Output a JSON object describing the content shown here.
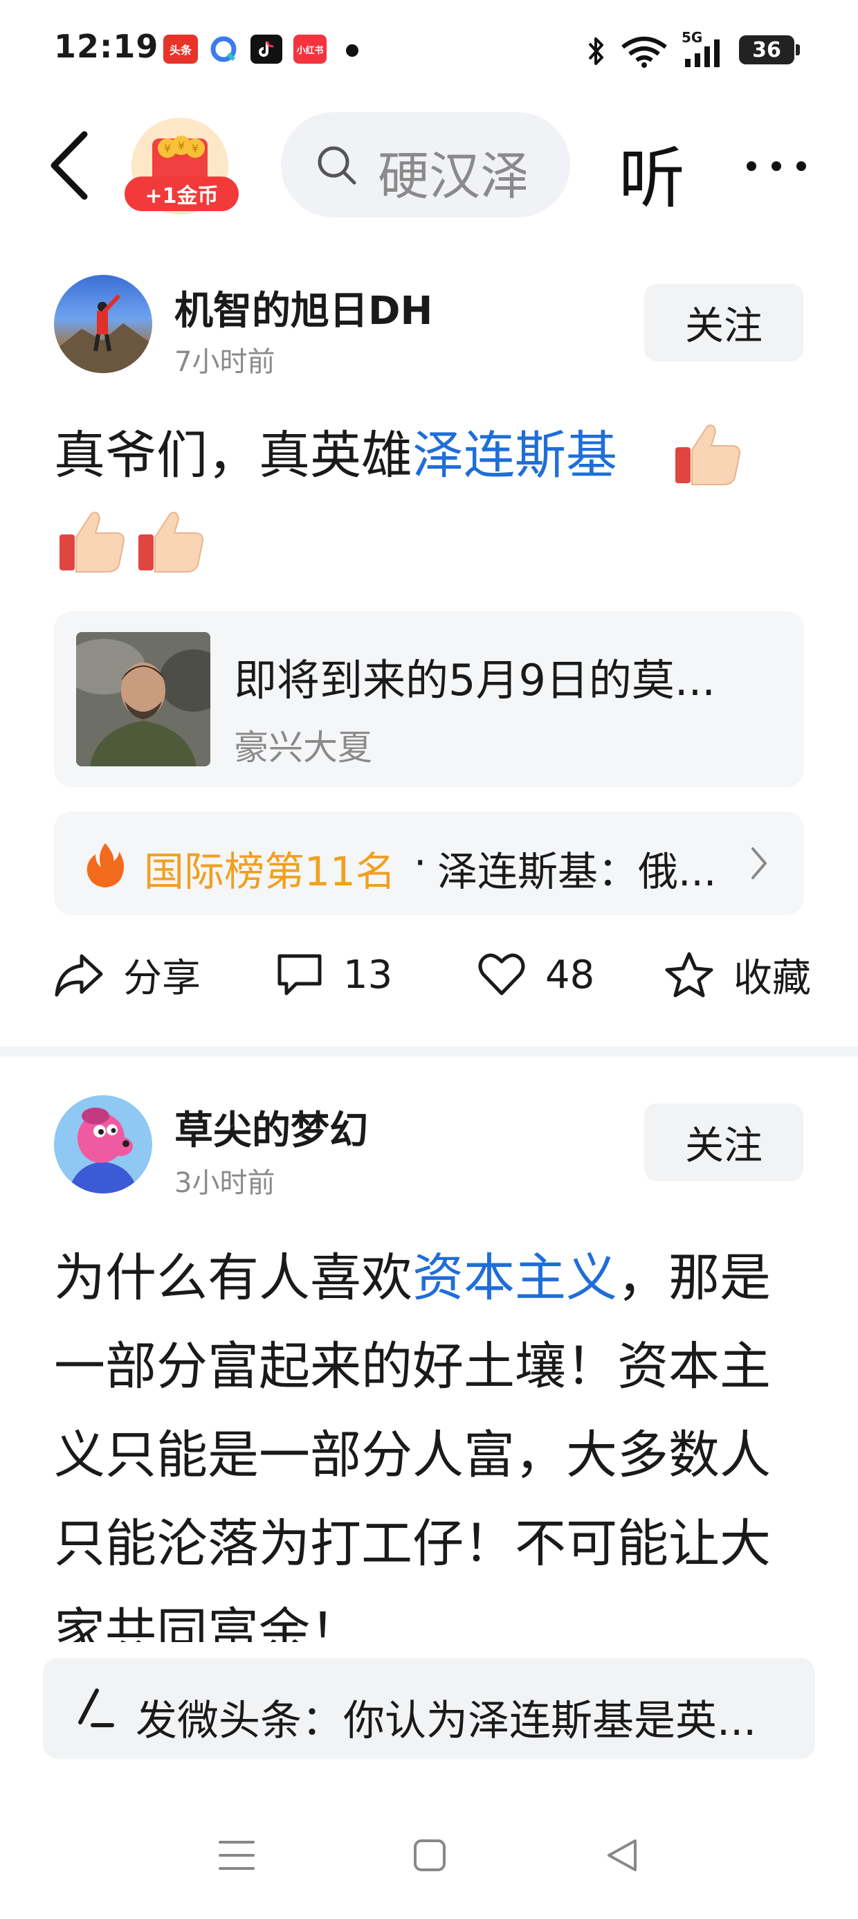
{
  "status_bar": {
    "time": "12:19",
    "app_icons": [
      {
        "name": "toutiao-app-icon",
        "label": "头条",
        "color": "#e8322a"
      },
      {
        "name": "browser-app-icon",
        "label": "",
        "color": "#3a7bf0"
      },
      {
        "name": "douyin-app-icon",
        "label": "",
        "color": "#111111"
      },
      {
        "name": "xiaohongshu-app-icon",
        "label": "小红书",
        "color": "#f5333f"
      }
    ],
    "network": "5G",
    "battery": "36"
  },
  "nav": {
    "coin_badge": "+1金币",
    "search_placeholder": "硬汉泽",
    "listen_label": "听"
  },
  "posts": [
    {
      "author": "机智的旭日DH",
      "time": "7小时前",
      "follow_label": "关注",
      "body_prefix": "真爷们，真英雄",
      "body_link": "泽连斯基",
      "body_suffix": "",
      "emojis": [
        "thumbs-up",
        "thumbs-up",
        "thumbs-up"
      ],
      "quoted_card": {
        "title": "即将到来的5月9日的莫...",
        "source": "豪兴大夏"
      },
      "ranking": {
        "rank_label": "国际榜第11名",
        "separator": "·",
        "topic": "泽连斯基：俄..."
      },
      "actions": {
        "share_label": "分享",
        "comment_count": "13",
        "like_count": "48",
        "favorite_label": "收藏"
      }
    },
    {
      "author": "草尖的梦幻",
      "time": "3小时前",
      "follow_label": "关注",
      "body_prefix": "为什么有人喜欢",
      "body_link": "资本主义",
      "body_suffix": "，那是一部分富起来的好土壤！资本主义只能是一部分人富，大多数人只能沦落为打工仔！不可能让大家共同富余！"
    }
  ],
  "compose": {
    "prompt": "发微头条：你认为泽连斯基是英..."
  },
  "colors": {
    "accent_link": "#1f6ed8",
    "rank_orange": "#f0a020",
    "coin_red": "#f23a3a"
  }
}
